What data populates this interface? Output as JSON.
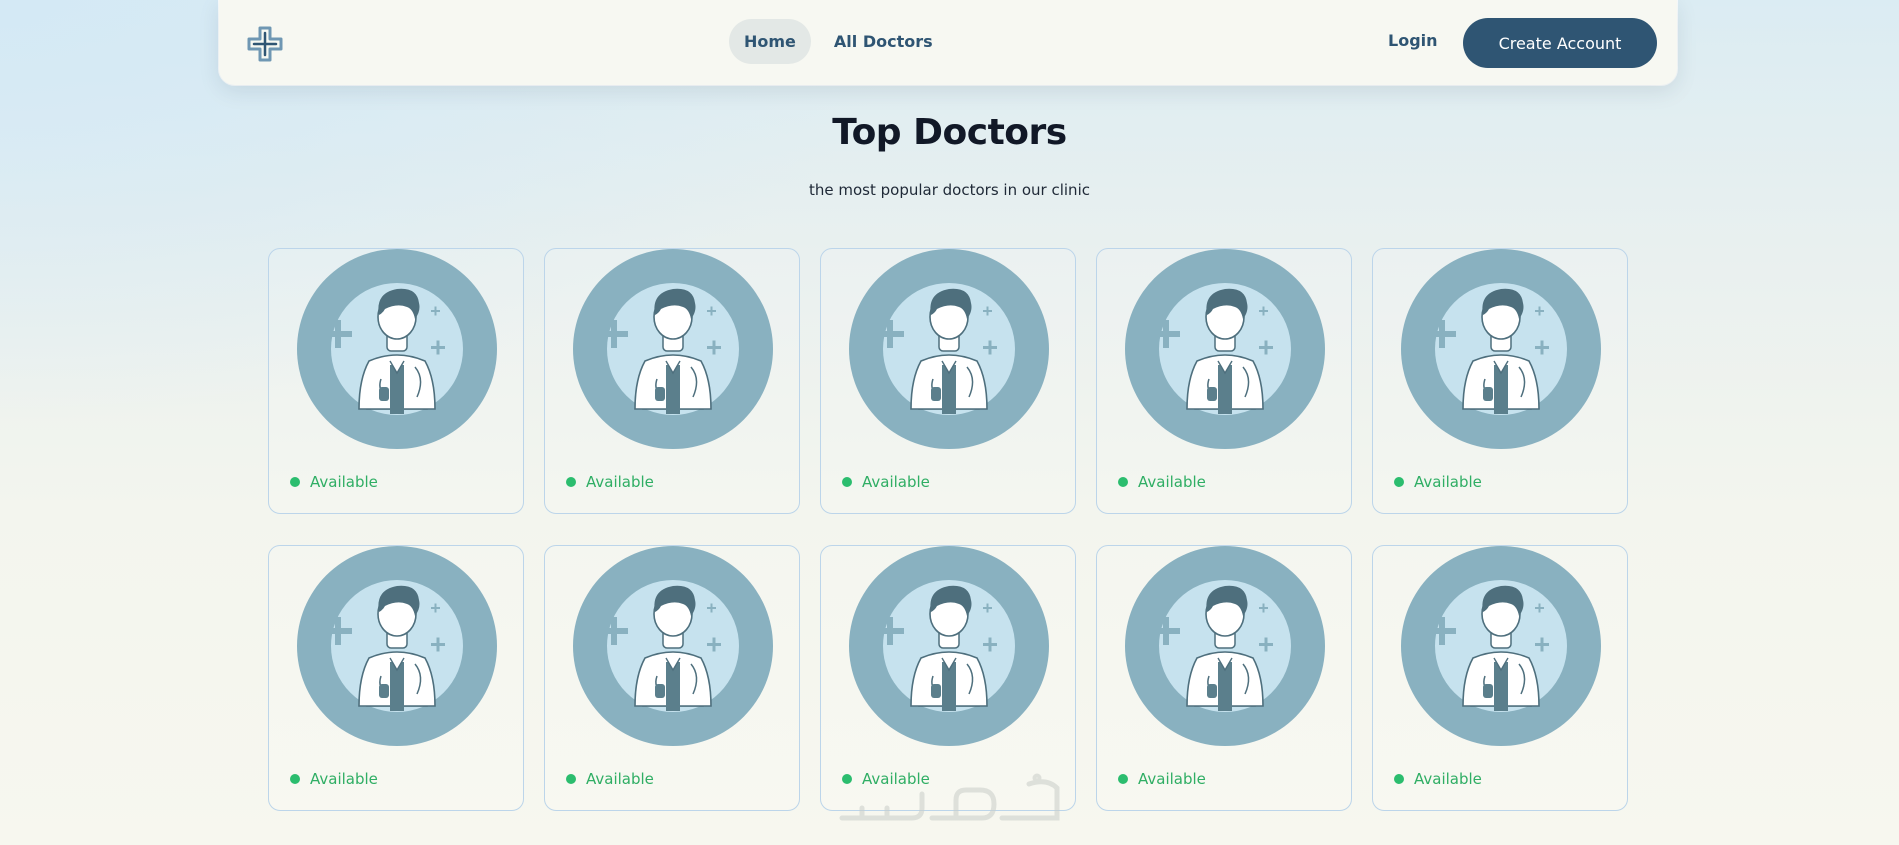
{
  "nav": {
    "logo_icon": "medical-cross-logo-icon",
    "links": [
      {
        "label": "Home",
        "active": true
      },
      {
        "label": "All Doctors",
        "active": false
      }
    ],
    "login_label": "Login",
    "create_account_label": "Create Account"
  },
  "page": {
    "title": "Top Doctors",
    "subtitle": "the most popular doctors in our clinic"
  },
  "doctors": [
    {
      "status": "Available"
    },
    {
      "status": "Available"
    },
    {
      "status": "Available"
    },
    {
      "status": "Available"
    },
    {
      "status": "Available"
    },
    {
      "status": "Available"
    },
    {
      "status": "Available"
    },
    {
      "status": "Available"
    },
    {
      "status": "Available"
    },
    {
      "status": "Available"
    }
  ],
  "colors": {
    "brand": "#2f5573",
    "available": "#2bbd6e",
    "card_border": "#bcd5ea",
    "avatar_ring": "#89b1c0",
    "avatar_inner": "#c6e2ee"
  }
}
